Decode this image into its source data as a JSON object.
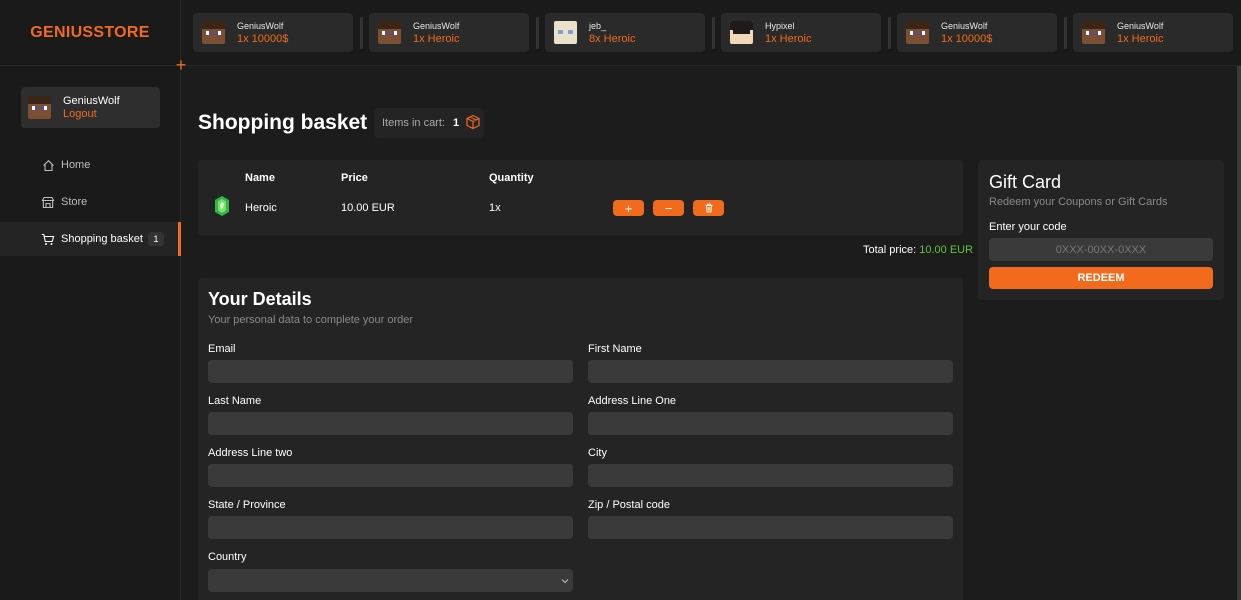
{
  "brand": {
    "name": "GENIUSSTORE",
    "color": "#f26b1d"
  },
  "user": {
    "name": "GeniusWolf",
    "logout_label": "Logout"
  },
  "nav": {
    "items": [
      {
        "label": "Home",
        "icon": "home-icon"
      },
      {
        "label": "Store",
        "icon": "store-icon"
      },
      {
        "label": "Shopping basket",
        "icon": "cart-icon",
        "badge": "1",
        "active": true
      }
    ]
  },
  "recent_purchases": [
    {
      "name": "GeniusWolf",
      "item": "1x 10000$",
      "avatar": "steve"
    },
    {
      "name": "GeniusWolf",
      "item": "1x Heroic",
      "avatar": "steve"
    },
    {
      "name": "jeb_",
      "item": "8x Heroic",
      "avatar": "jeb"
    },
    {
      "name": "Hypixel",
      "item": "1x Heroic",
      "avatar": "hypixel"
    },
    {
      "name": "GeniusWolf",
      "item": "1x 10000$",
      "avatar": "steve"
    },
    {
      "name": "GeniusWolf",
      "item": "1x Heroic",
      "avatar": "steve"
    }
  ],
  "main": {
    "title": "Shopping basket",
    "items_in_cart_label": "Items in cart:",
    "items_in_cart_count": "1"
  },
  "basket": {
    "headers": {
      "name": "Name",
      "price": "Price",
      "quantity": "Quantity"
    },
    "rows": [
      {
        "name": "Heroic",
        "price": "10.00 EUR",
        "quantity": "1x",
        "icon": "emerald-gem-icon"
      }
    ],
    "total_label": "Total price:",
    "total_value": "10.00 EUR",
    "total_color": "#5cc43b"
  },
  "details": {
    "title": "Your Details",
    "subtitle": "Your personal data to complete your order",
    "fields": {
      "email": "Email",
      "first_name": "First Name",
      "last_name": "Last Name",
      "address_one": "Address Line One",
      "address_two": "Address Line two",
      "city": "City",
      "state": "State / Province",
      "zip": "Zip / Postal code",
      "country": "Country"
    }
  },
  "gift_card": {
    "title": "Gift Card",
    "subtitle": "Redeem your Coupons or Gift Cards",
    "code_label": "Enter your code",
    "code_placeholder": "0XXX-00XX-0XXX",
    "redeem_label": "REDEEM"
  }
}
